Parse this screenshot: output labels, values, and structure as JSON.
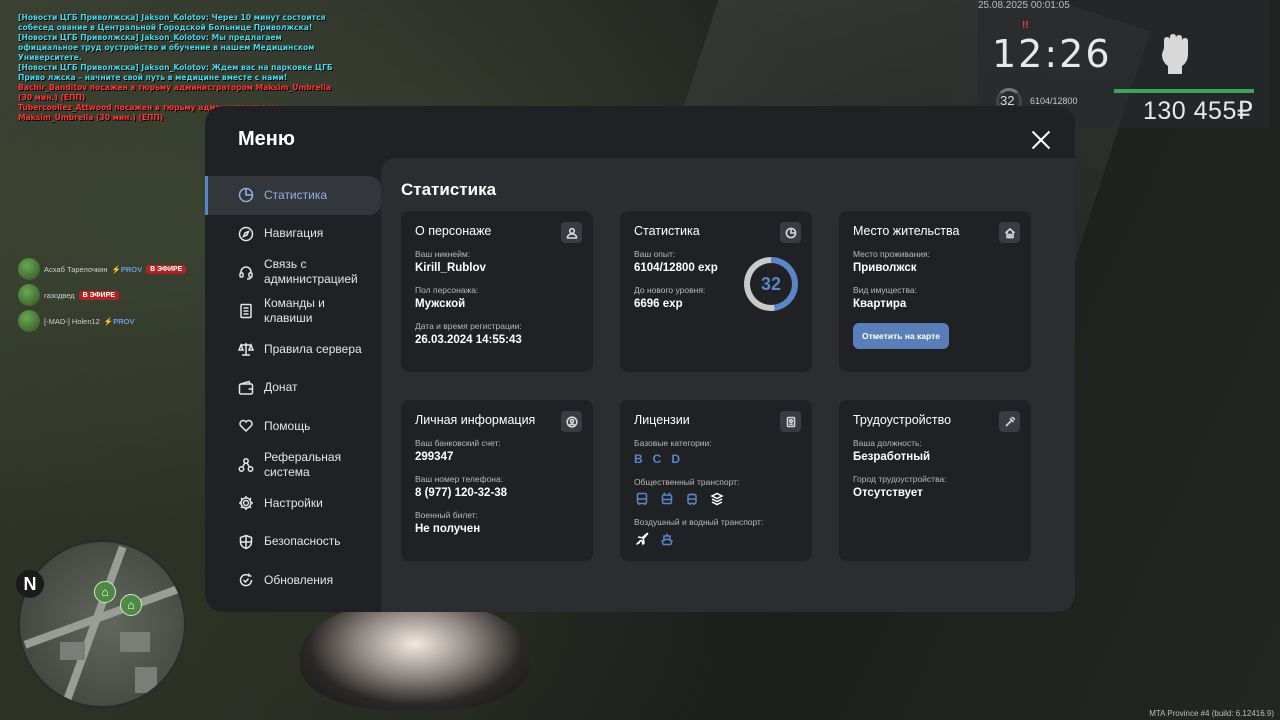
{
  "chat": {
    "lines": [
      {
        "type": "news",
        "text": "[Новости ЦГБ Приволжска] Jakson_Kolotov: Через 10 минут состоится собесед ование в Центральной Городской Больнице Приволжска!"
      },
      {
        "type": "news",
        "text": "[Новости ЦГБ Приволжска] Jakson_Kolotov: Мы предлагаем официальное труд оустройство и обучение в нашем Медицинском Университете."
      },
      {
        "type": "news",
        "text": "[Новости ЦГБ Приволжска] Jakson_Kolotov: Ждем вас на парковке ЦГБ Приво лжска – начните свой путь в медицине вместе с нами!"
      },
      {
        "type": "ban",
        "text": "Bachir_Banditov посажен в тюрьму администратором Maksim_Umbrella (30 мин.) (ЕПП)"
      },
      {
        "type": "ban",
        "text": "Tubercoollez_Attwood посажен в тюрьму администратором Maksim_Umbrella (30 мин.) (ЕПП)"
      }
    ]
  },
  "voice": [
    {
      "name": "Асхаб Тарелочкин",
      "prov": "PROV",
      "air": "В ЭФИРЕ"
    },
    {
      "name": "газодвед",
      "prov": "",
      "air": "В ЭФИРЕ"
    },
    {
      "name": "[-MAD-] Holen12",
      "prov": "PROV",
      "air": ""
    }
  ],
  "hud": {
    "date": "25.08.2025 00:01:05",
    "time": "12:26",
    "warn": "!!",
    "level": "32",
    "exp": "6104/12800",
    "money": "130 455₽"
  },
  "minimap": {
    "north": "N"
  },
  "build": "MTA Province #4 (build: 6.12416.9)",
  "menu": {
    "title": "Меню",
    "nav": [
      {
        "label": "Статистика",
        "icon": "pie-chart-icon"
      },
      {
        "label": "Навигация",
        "icon": "compass-icon"
      },
      {
        "label": "Связь с администрацией",
        "icon": "headset-icon"
      },
      {
        "label": "Команды и клавиши",
        "icon": "document-icon"
      },
      {
        "label": "Правила сервера",
        "icon": "scales-icon"
      },
      {
        "label": "Донат",
        "icon": "wallet-icon"
      },
      {
        "label": "Помощь",
        "icon": "heart-hand-icon"
      },
      {
        "label": "Реферальная система",
        "icon": "network-icon"
      },
      {
        "label": "Настройки",
        "icon": "gear-icon"
      },
      {
        "label": "Безопасность",
        "icon": "shield-icon"
      },
      {
        "label": "Обновления",
        "icon": "refresh-check-icon"
      }
    ],
    "content_title": "Статистика",
    "cards": {
      "character": {
        "title": "О персонаже",
        "nick_label": "Ваш никнейм:",
        "nick": "Kirill_Rublov",
        "gender_label": "Пол персонажа:",
        "gender": "Мужской",
        "reg_label": "Дата и время регистрации:",
        "reg": "26.03.2024 14:55:43"
      },
      "stats": {
        "title": "Статистика",
        "exp_label": "Ваш опыт:",
        "exp": "6104/12800 exp",
        "next_label": "До нового уровня:",
        "next": "6696 exp",
        "level": "32",
        "progress": 0.477
      },
      "residence": {
        "title": "Место жительства",
        "place_label": "Место проживания:",
        "place": "Приволжск",
        "property_label": "Вид имущества:",
        "property": "Квартира",
        "button": "Отметить на карте"
      },
      "personal": {
        "title": "Личная информация",
        "bank_label": "Ваш банковский счет:",
        "bank": "299347",
        "phone_label": "Ваш номер телефона:",
        "phone": "8 (977) 120-32-38",
        "military_label": "Военный билет:",
        "military": "Не получен"
      },
      "licenses": {
        "title": "Лицензии",
        "base_label": "Базовые категории:",
        "categories": [
          "B",
          "C",
          "D"
        ],
        "public_label": "Общественный транспорт:",
        "air_label": "Воздушный и водный транспорт:"
      },
      "employment": {
        "title": "Трудоустройство",
        "position_label": "Ваша должность:",
        "position": "Безработный",
        "city_label": "Город трудоустройства:",
        "city": "Отсутствует"
      }
    }
  },
  "colors": {
    "accent": "#5b85c7",
    "card": "#202124",
    "panel": "#2c2d30"
  }
}
